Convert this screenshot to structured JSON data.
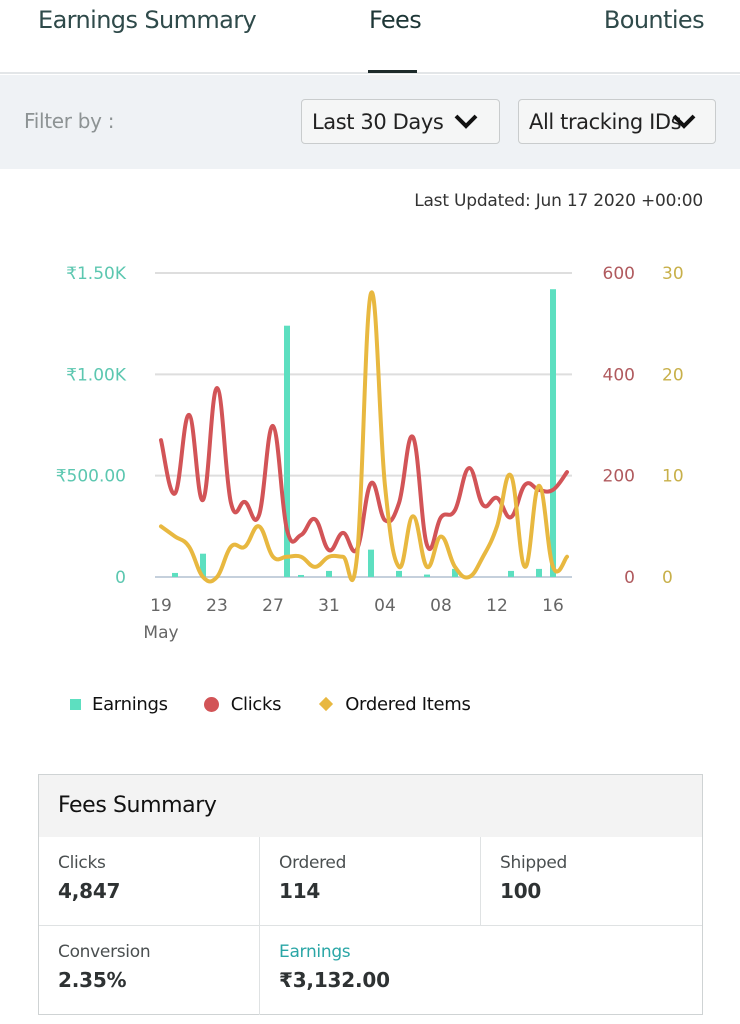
{
  "tabs": [
    {
      "label": "Earnings Summary",
      "active": false
    },
    {
      "label": "Fees",
      "active": true
    },
    {
      "label": "Bounties",
      "active": false
    }
  ],
  "filter": {
    "label": "Filter by :",
    "date_range": "Last 30 Days",
    "tracking_id": "All tracking IDs"
  },
  "last_updated": "Last Updated: Jun 17 2020 +00:00",
  "legend": {
    "earnings": "Earnings",
    "clicks": "Clicks",
    "ordered_items": "Ordered Items"
  },
  "colors": {
    "earnings": "#5ddfc0",
    "clicks": "#d25457",
    "ordered_items": "#e8b840",
    "left_axis": "#5cc7b0",
    "clicks_axis": "#b05a5e",
    "ordered_axis": "#c8b04a"
  },
  "chart_data": {
    "type": "bar+line",
    "title": "",
    "x": [
      "May 19",
      "May 20",
      "May 21",
      "May 22",
      "May 23",
      "May 24",
      "May 25",
      "May 26",
      "May 27",
      "May 28",
      "May 29",
      "May 30",
      "May 31",
      "Jun 01",
      "Jun 02",
      "Jun 03",
      "Jun 04",
      "Jun 05",
      "Jun 06",
      "Jun 07",
      "Jun 08",
      "Jun 09",
      "Jun 10",
      "Jun 11",
      "Jun 12",
      "Jun 13",
      "Jun 14",
      "Jun 15",
      "Jun 16",
      "Jun 17"
    ],
    "x_tick_labels": [
      "19",
      "23",
      "27",
      "31",
      "04",
      "08",
      "12",
      "16"
    ],
    "x_tick_indices": [
      0,
      4,
      8,
      12,
      16,
      20,
      24,
      28
    ],
    "x_sub_label": "May",
    "series": [
      {
        "name": "Earnings",
        "type": "bar",
        "axis": "left",
        "values": [
          0,
          20,
          0,
          115,
          0,
          0,
          0,
          0,
          0,
          1240,
          10,
          0,
          30,
          0,
          0,
          135,
          0,
          30,
          0,
          12,
          0,
          40,
          0,
          0,
          0,
          30,
          0,
          40,
          1420,
          0
        ]
      },
      {
        "name": "Clicks",
        "type": "line",
        "axis": "right1",
        "values": [
          270,
          165,
          320,
          152,
          373,
          146,
          148,
          122,
          298,
          93,
          83,
          114,
          53,
          87,
          55,
          185,
          112,
          146,
          276,
          63,
          118,
          132,
          215,
          142,
          156,
          118,
          182,
          172,
          172,
          207
        ]
      },
      {
        "name": "Ordered Items",
        "type": "line",
        "axis": "right2",
        "values": [
          5,
          4,
          3,
          0,
          0,
          3,
          3,
          5,
          2,
          2,
          2,
          1,
          2,
          2,
          2,
          28,
          9,
          1,
          6,
          1,
          4,
          1,
          0,
          2,
          5,
          10,
          1,
          9,
          1,
          2
        ]
      }
    ],
    "axes": {
      "left": {
        "ylim": [
          0,
          1500
        ],
        "ticks": [
          0,
          500,
          1000,
          1500
        ],
        "tick_labels": [
          "0",
          "₹500.00",
          "₹1.00K",
          "₹1.50K"
        ]
      },
      "right1": {
        "ylim": [
          0,
          600
        ],
        "ticks": [
          0,
          200,
          400,
          600
        ],
        "tick_labels": [
          "0",
          "200",
          "400",
          "600"
        ]
      },
      "right2": {
        "ylim": [
          0,
          30
        ],
        "ticks": [
          0,
          10,
          20,
          30
        ],
        "tick_labels": [
          "0",
          "10",
          "20",
          "30"
        ]
      }
    },
    "grid": true,
    "legend_position": "bottom-left"
  },
  "summary": {
    "title": "Fees Summary",
    "clicks_label": "Clicks",
    "clicks_value": "4,847",
    "ordered_label": "Ordered",
    "ordered_value": "114",
    "shipped_label": "Shipped",
    "shipped_value": "100",
    "conversion_label": "Conversion",
    "conversion_value": "2.35%",
    "earnings_label": "Earnings",
    "earnings_value": "₹3,132.00"
  }
}
